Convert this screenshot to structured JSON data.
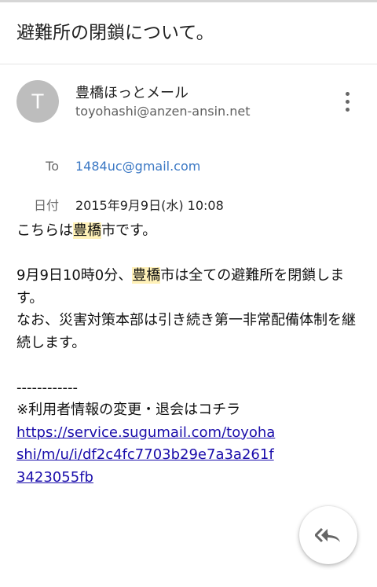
{
  "subject": "避難所の閉鎖について。",
  "sender": {
    "avatar_letter": "T",
    "name": "豊橋ほっとメール",
    "email": "toyohashi@anzen-ansin.net"
  },
  "meta": {
    "to_label": "To",
    "to_value": "1484uc@gmail.com",
    "date_label": "日付",
    "date_value": "2015年9月9日(水) 10:08"
  },
  "body": {
    "line1_pre": "こちらは",
    "city": "豊橋",
    "line1_post": "市です。",
    "para2_pre": "9月9日10時0分、",
    "para2_post": "市は全ての避難所を閉鎖します。",
    "para3": "なお、災害対策本部は引き続き第一非常配備体制を継続します。",
    "separator": "------------",
    "notice": "※利用者情報の変更・退会はコチラ",
    "link": "https://service.sugumail.com/toyohashi/m/u/i/df2c4fc7703b29e7a3a261f3423055fb"
  },
  "icons": {
    "menu": "more-vert-icon",
    "reply_all": "reply-all-icon"
  },
  "colors": {
    "avatar_bg": "#bdbdbd",
    "to_link": "#3b78c4",
    "body_link": "#1a0dab",
    "highlight": "#fff1b8"
  }
}
